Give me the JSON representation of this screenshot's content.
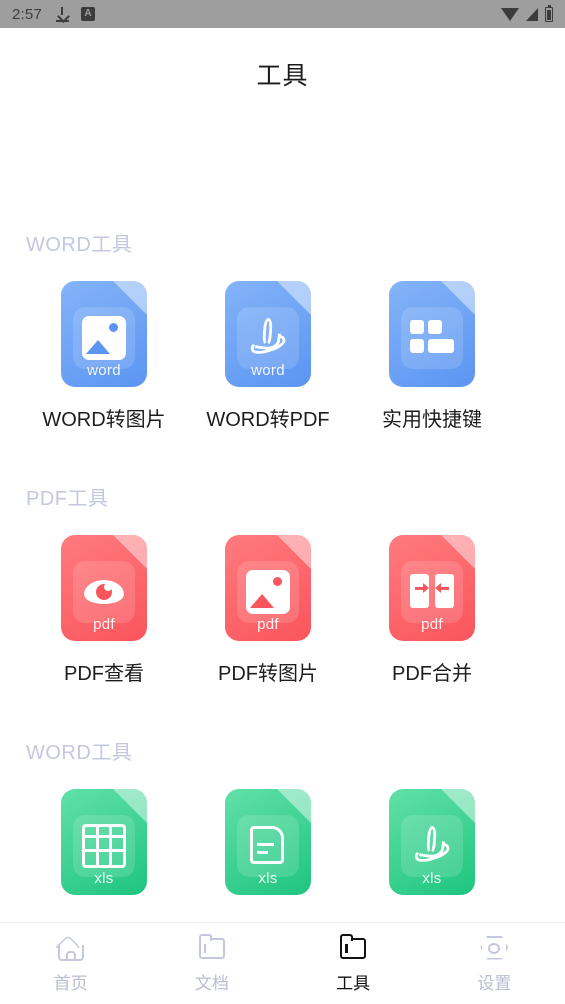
{
  "status_bar": {
    "time": "2:57",
    "left_icons": [
      "download-icon",
      "a-badge-icon"
    ],
    "right_icons": [
      "wifi-icon",
      "signal-icon",
      "battery-icon"
    ],
    "a_badge_text": "A",
    "background": "#9e9e9e"
  },
  "header": {
    "title": "工具"
  },
  "colors": {
    "blue": "#5b94f2",
    "red": "#f9555c",
    "green": "#1ec57f",
    "section_title": "#c3c8df",
    "nav_inactive": "#b9bdd2",
    "nav_active": "#111111"
  },
  "sections": [
    {
      "title": "WORD工具",
      "items": [
        {
          "label": "WORD转图片",
          "ext": "word",
          "color": "blue",
          "icon": "image-glyph-icon"
        },
        {
          "label": "WORD转PDF",
          "ext": "word",
          "color": "blue",
          "icon": "pdf-glyph-icon"
        },
        {
          "label": "实用快捷键",
          "ext": "",
          "color": "blue",
          "icon": "shortcut-blocks-icon"
        }
      ]
    },
    {
      "title": "PDF工具",
      "items": [
        {
          "label": "PDF查看",
          "ext": "pdf",
          "color": "red",
          "icon": "eye-glyph-icon"
        },
        {
          "label": "PDF转图片",
          "ext": "pdf",
          "color": "red",
          "icon": "image-glyph-icon"
        },
        {
          "label": "PDF合并",
          "ext": "pdf",
          "color": "red",
          "icon": "merge-glyph-icon"
        }
      ]
    },
    {
      "title": "WORD工具",
      "items": [
        {
          "label": "",
          "ext": "xls",
          "color": "green",
          "icon": "table-glyph-icon"
        },
        {
          "label": "",
          "ext": "xls",
          "color": "green",
          "icon": "document-glyph-icon"
        },
        {
          "label": "",
          "ext": "xls",
          "color": "green",
          "icon": "pdf-glyph-icon"
        }
      ]
    }
  ],
  "bottom_nav": {
    "items": [
      {
        "label": "首页",
        "icon": "home-icon",
        "active": false
      },
      {
        "label": "文档",
        "icon": "folder-icon",
        "active": false
      },
      {
        "label": "工具",
        "icon": "tools-folder-icon",
        "active": true
      },
      {
        "label": "设置",
        "icon": "settings-hex-icon",
        "active": false
      }
    ]
  }
}
